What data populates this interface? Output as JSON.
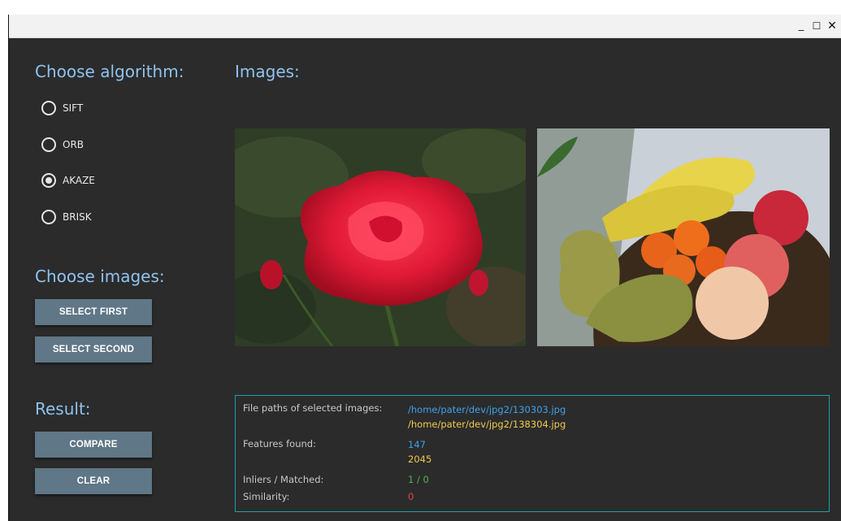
{
  "window": {
    "controls": {
      "minimize": "_",
      "maximize": "☐",
      "close": "✕"
    }
  },
  "sidebar": {
    "algorithm_heading": "Choose algorithm:",
    "algorithms": [
      {
        "label": "SIFT",
        "checked": false
      },
      {
        "label": "ORB",
        "checked": false
      },
      {
        "label": "AKAZE",
        "checked": true
      },
      {
        "label": "BRISK",
        "checked": false
      }
    ],
    "images_heading": "Choose images:",
    "select_first_label": "SELECT FIRST",
    "select_second_label": "SELECT SECOND",
    "result_heading": "Result:",
    "compare_label": "COMPARE",
    "clear_label": "CLEAR"
  },
  "main": {
    "images_heading": "Images:"
  },
  "results": {
    "file_paths_label": "File paths of selected images:",
    "file_path_first": "/home/pater/dev/jpg2/130303.jpg",
    "file_path_second": "/home/pater/dev/jpg2/138304.jpg",
    "features_label": "Features found:",
    "features_first": "147",
    "features_second": "2045",
    "inliers_label": "Inliers / Matched:",
    "inliers_value": "1 / 0",
    "similarity_label": "Similarity:",
    "similarity_value": "0"
  },
  "colors": {
    "background": "#2b2b2b",
    "heading": "#8fc3ef",
    "button": "#5f7786",
    "box_border": "#19a3a3",
    "first_value": "#3ea2ea",
    "second_value": "#f2c94c",
    "inliers": "#4fb34f",
    "similarity": "#e0443a"
  }
}
